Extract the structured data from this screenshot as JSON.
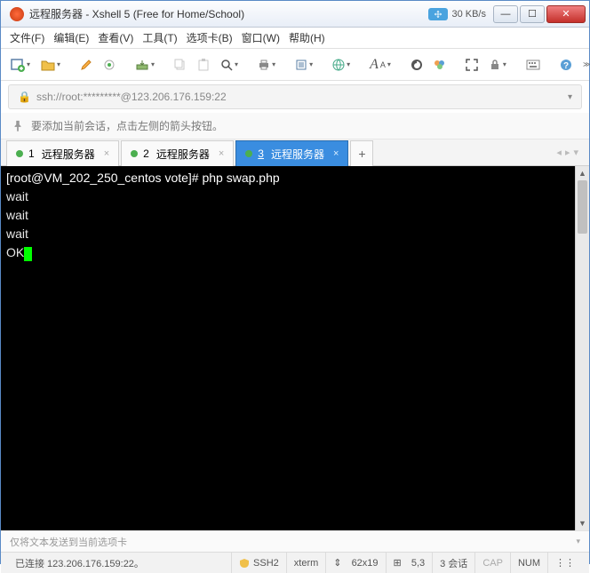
{
  "titlebar": {
    "title": "远程服务器 - Xshell 5 (Free for Home/School)",
    "speed": "30 KB/s"
  },
  "menu": {
    "file": "文件(F)",
    "edit": "编辑(E)",
    "view": "查看(V)",
    "tools": "工具(T)",
    "tabs": "选项卡(B)",
    "window": "窗口(W)",
    "help": "帮助(H)"
  },
  "address": {
    "url": "ssh://root:*********@123.206.176.159:22"
  },
  "infobar": {
    "text": "要添加当前会话，点击左侧的箭头按钮。"
  },
  "tabs": {
    "items": [
      {
        "num": "1",
        "label": "远程服务器",
        "active": false
      },
      {
        "num": "2",
        "label": "远程服务器",
        "active": false
      },
      {
        "num": "3",
        "label": "远程服务器",
        "active": true
      }
    ],
    "add": "+"
  },
  "terminal": {
    "prompt": "[root@VM_202_250_centos vote]# ",
    "command": "php swap.php",
    "lines": [
      "wait",
      "wait",
      "wait",
      "OK"
    ]
  },
  "sendbar": {
    "text": "仅将文本发送到当前选项卡"
  },
  "status": {
    "conn": "已连接 123.206.176.159:22。",
    "proto": "SSH2",
    "term": "xterm",
    "size_icon": "⇕",
    "size": "62x19",
    "pos_icon": "⊞",
    "pos": "5,3",
    "sessions": "3 会话",
    "cap": "CAP",
    "num": "NUM",
    "end_icon": "↔",
    "end": "⋮⋮"
  }
}
